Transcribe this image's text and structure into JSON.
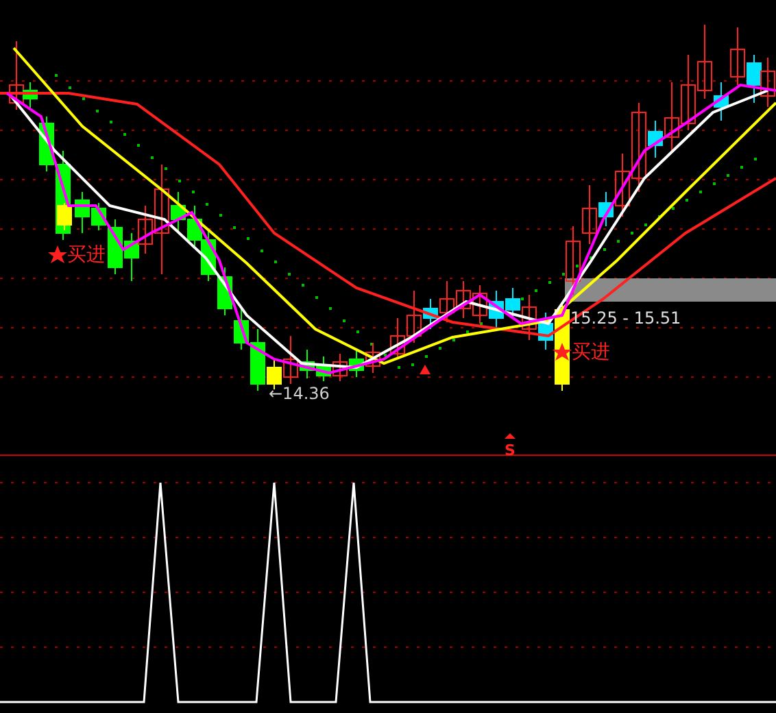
{
  "price_panel": {
    "labels": [
      {
        "kind": "buy",
        "text": "买进"
      },
      {
        "kind": "low",
        "text": "←14.36"
      },
      {
        "kind": "range",
        "text": "15.25 - 15.51"
      },
      {
        "kind": "buy",
        "text": "买进"
      }
    ]
  },
  "indicator_panel": {
    "signal": "S"
  }
}
